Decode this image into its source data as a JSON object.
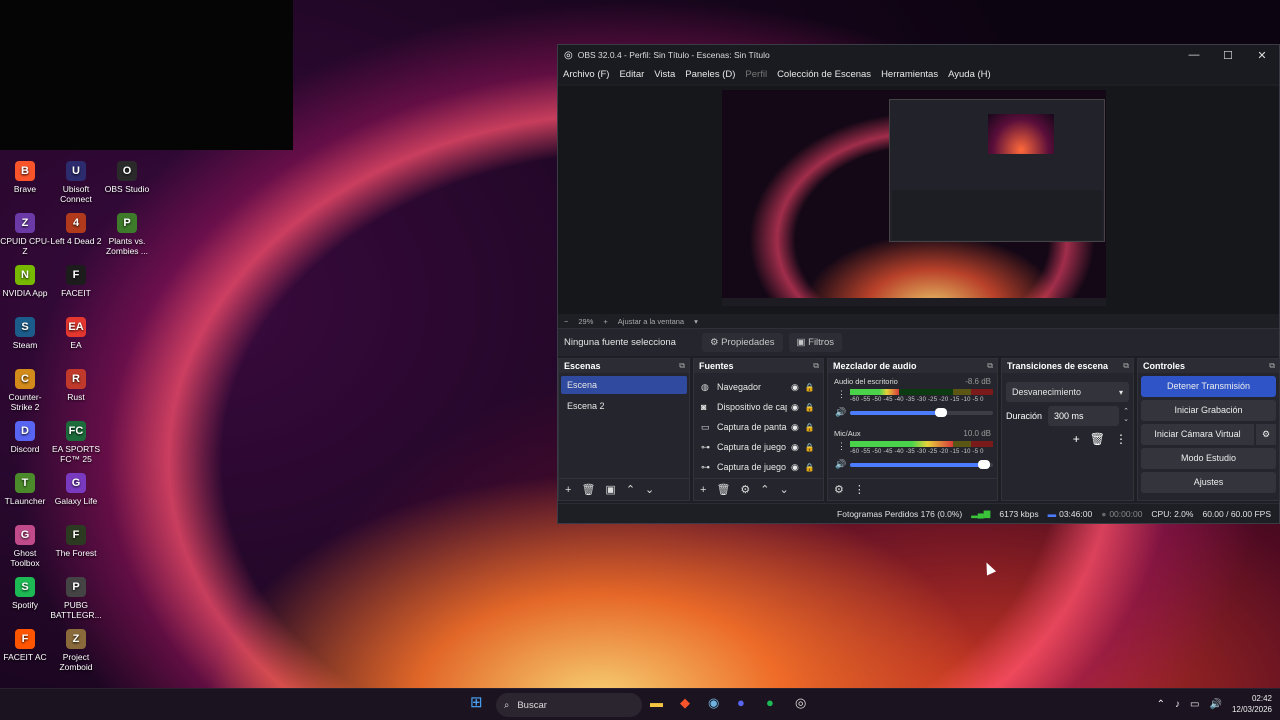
{
  "desktop": {
    "icons": [
      {
        "label": "Brave",
        "color": "#fb542b",
        "glyph": "B"
      },
      {
        "label": "Ubisoft Connect",
        "color": "#2b2b6e",
        "glyph": "U"
      },
      {
        "label": "OBS Studio",
        "color": "#2a2a2a",
        "glyph": "O"
      },
      {
        "label": "CPUID CPU-Z",
        "color": "#6b3aa6",
        "glyph": "Z"
      },
      {
        "label": "Left 4 Dead 2",
        "color": "#b23a1c",
        "glyph": "4"
      },
      {
        "label": "Plants vs. Zombies ...",
        "color": "#3d7a2a",
        "glyph": "P"
      },
      {
        "label": "NVIDIA App",
        "color": "#76b900",
        "glyph": "N"
      },
      {
        "label": "FACEIT",
        "color": "#1c1c1c",
        "glyph": "F"
      },
      {
        "label": "Steam",
        "color": "#1b5c8a",
        "glyph": "S"
      },
      {
        "label": "EA",
        "color": "#e4372f",
        "glyph": "EA"
      },
      {
        "label": "Counter-Strike 2",
        "color": "#d28a1a",
        "glyph": "C"
      },
      {
        "label": "Rust",
        "color": "#c0392b",
        "glyph": "R"
      },
      {
        "label": "Discord",
        "color": "#5865f2",
        "glyph": "D"
      },
      {
        "label": "EA SPORTS FC™ 25",
        "color": "#1c6b3a",
        "glyph": "FC"
      },
      {
        "label": "TLauncher",
        "color": "#4a8a2a",
        "glyph": "T"
      },
      {
        "label": "Galaxy Life",
        "color": "#7a3ac0",
        "glyph": "G"
      },
      {
        "label": "Ghost Toolbox",
        "color": "#c04a8a",
        "glyph": "G"
      },
      {
        "label": "The Forest",
        "color": "#2d3a22",
        "glyph": "F"
      },
      {
        "label": "Spotify",
        "color": "#1db954",
        "glyph": "S"
      },
      {
        "label": "PUBG BATTLEGR...",
        "color": "#444444",
        "glyph": "P"
      },
      {
        "label": "FACEIT AC",
        "color": "#ff5500",
        "glyph": "F"
      },
      {
        "label": "Project Zomboid",
        "color": "#8a6a3a",
        "glyph": "Z"
      }
    ]
  },
  "obs": {
    "title": "OBS 32.0.4 - Perfil: Sin Título - Escenas: Sin Título",
    "menu": [
      "Archivo (F)",
      "Editar",
      "Vista",
      "Paneles (D)",
      "Perfil",
      "Colección de Escenas",
      "Herramientas",
      "Ayuda (H)"
    ],
    "zoom": {
      "minus": "−",
      "value": "29%",
      "plus": "+",
      "fit": "Ajustar a la ventana"
    },
    "source_bar": {
      "label": "Ninguna fuente selecciona",
      "properties": "Propiedades",
      "filters": "Filtros"
    },
    "scenes": {
      "title": "Escenas",
      "items": [
        "Escena",
        "Escena 2"
      ],
      "selected": "Escena"
    },
    "sources": {
      "title": "Fuentes",
      "items": [
        "Navegador",
        "Dispositivo de captura",
        "Captura de pantalla",
        "Captura de juego",
        "Captura de juego"
      ]
    },
    "mixer": {
      "title": "Mezclador de audio",
      "tracks": [
        {
          "name": "Audio del escritorio",
          "db": "-8.6 dB",
          "level": 0.34,
          "volume": 0.68
        },
        {
          "name": "Mic/Aux",
          "db": "10.0 dB",
          "level": 0.72,
          "volume": 0.98
        }
      ],
      "scale": "-60 -55 -50 -45 -40 -35 -30 -25 -20 -15 -10 -5 0"
    },
    "transitions": {
      "title": "Transiciones de escena",
      "selected": "Desvanecimiento",
      "duration_label": "Duración",
      "duration_value": "300 ms"
    },
    "controls": {
      "title": "Controles",
      "stop_stream": "Detener Transmisión",
      "start_record": "Iniciar Grabación",
      "virtual_cam": "Iniciar Cámara Virtual",
      "studio_mode": "Modo Estudio",
      "settings": "Ajustes"
    },
    "status": {
      "dropped": "Fotogramas Perdidos 176 (0.0%)",
      "bitrate": "6173 kbps",
      "stream_time": "03:46:00",
      "record_time": "00:00:00",
      "cpu": "CPU: 2.0%",
      "fps": "60.00 / 60.00 FPS"
    }
  },
  "taskbar": {
    "search_placeholder": "Buscar",
    "time": "02:42",
    "date": "12/03/2026"
  }
}
